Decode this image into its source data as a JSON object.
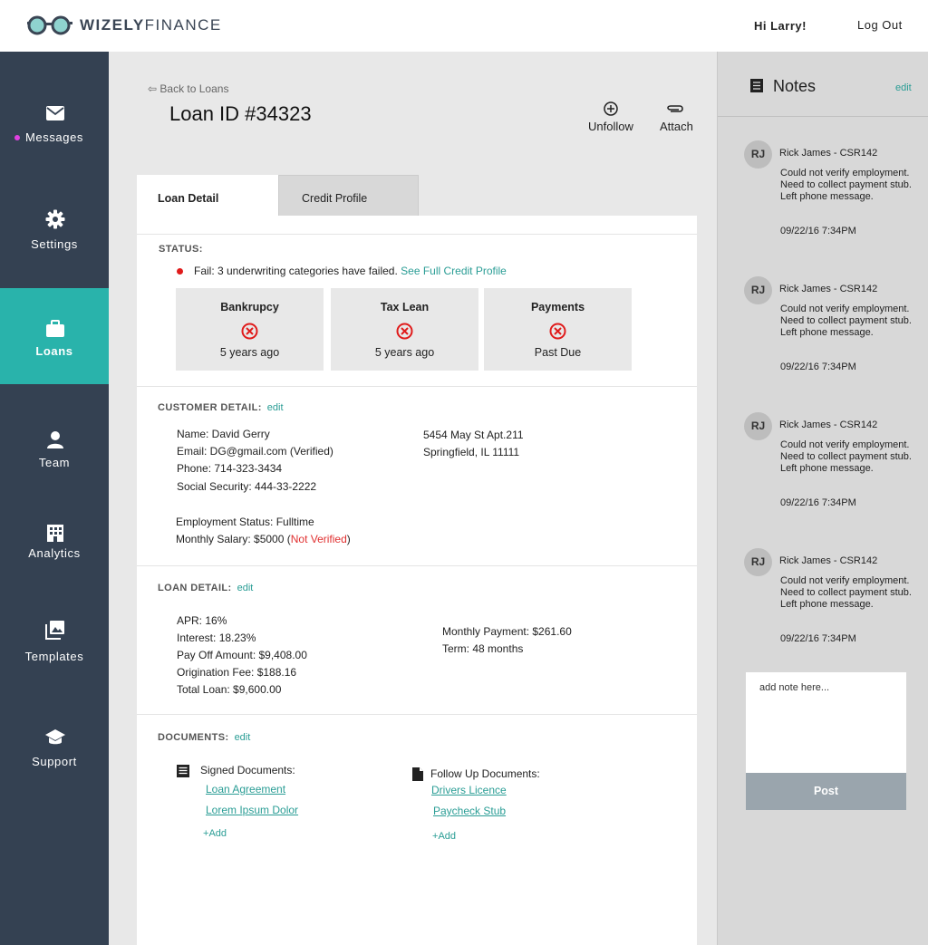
{
  "brand": {
    "name_bold": "WIZELY",
    "name_light": "FINANCE"
  },
  "header": {
    "greeting": "Hi Larry!",
    "logout": "Log Out"
  },
  "sidebar": {
    "items": [
      {
        "label": "Messages",
        "icon": "envelope-icon",
        "unread": true
      },
      {
        "label": "Settings",
        "icon": "gear-icon"
      },
      {
        "label": "Loans",
        "icon": "briefcase-icon",
        "active": true
      },
      {
        "label": "Team",
        "icon": "person-icon"
      },
      {
        "label": "Analytics",
        "icon": "building-icon"
      },
      {
        "label": "Templates",
        "icon": "images-icon"
      },
      {
        "label": "Support",
        "icon": "graduation-cap-icon"
      }
    ]
  },
  "colors": {
    "sidebar": "#344152",
    "accent": "#29b3ab",
    "link": "#2a9d95",
    "error": "#e01b1b"
  },
  "loan": {
    "back": "Back to Loans",
    "title": "Loan ID #34323",
    "actions": {
      "unfollow": "Unfollow",
      "attach": "Attach"
    },
    "tabs": [
      "Loan Detail",
      "Credit Profile"
    ],
    "status": {
      "title": "STATUS:",
      "message": "Fail: 3 underwriting categories have failed.",
      "link": "See Full Credit Profile",
      "cards": [
        {
          "title": "Bankrupcy",
          "sub": "5 years ago"
        },
        {
          "title": "Tax Lean",
          "sub": "5 years ago"
        },
        {
          "title": "Payments",
          "sub": "Past Due"
        }
      ]
    },
    "customer": {
      "title": "CUSTOMER DETAIL:",
      "edit": "edit",
      "name": "Name: David Gerry",
      "email": "Email: DG@gmail.com (Verified)",
      "phone": "Phone: 714-323-3434",
      "ssn": "Social Security: 444-33-2222",
      "address1": "5454 May St Apt.211",
      "address2": "Springfield, IL 11111",
      "employment": "Employment Status: Fulltime",
      "salary": "Monthly Salary: $5000 (",
      "salary_flag": "Not Verified",
      "salary_close": ")"
    },
    "detail": {
      "title": "LOAN DETAIL:",
      "edit": "edit",
      "apr": "APR: 16%",
      "interest": "Interest: 18.23%",
      "payoff": "Pay Off Amount: $9,408.00",
      "origination": "Origination Fee: $188.16",
      "total": "Total Loan: $9,600.00",
      "monthly": "Monthly Payment: $261.60",
      "term": "Term: 48 months"
    },
    "documents": {
      "title": "DOCUMENTS:",
      "edit": "edit",
      "signed_label": "Signed Documents:",
      "signed": [
        "Loan Agreement",
        "Lorem Ipsum Dolor"
      ],
      "followup_label": "Follow Up Documents:",
      "followup": [
        "Drivers Licence",
        "Paycheck Stub"
      ],
      "add": "Add"
    }
  },
  "notes": {
    "title": "Notes",
    "edit": "edit",
    "items": [
      {
        "initials": "RJ",
        "author": "Rick James - CSR142",
        "text": "Could not verify employment. Need to collect payment stub. Left phone message.",
        "time": "09/22/16 7:34PM"
      },
      {
        "initials": "RJ",
        "author": "Rick James - CSR142",
        "text": "Could not verify employment. Need to collect payment stub. Left phone message.",
        "time": "09/22/16 7:34PM"
      },
      {
        "initials": "RJ",
        "author": "Rick James - CSR142",
        "text": "Could not verify employment. Need to collect payment stub. Left phone message.",
        "time": "09/22/16 7:34PM"
      },
      {
        "initials": "RJ",
        "author": "Rick James - CSR142",
        "text": "Could not verify employment. Need to collect payment stub. Left phone message.",
        "time": "09/22/16 7:34PM"
      }
    ],
    "placeholder": "add note here...",
    "post": "Post"
  }
}
